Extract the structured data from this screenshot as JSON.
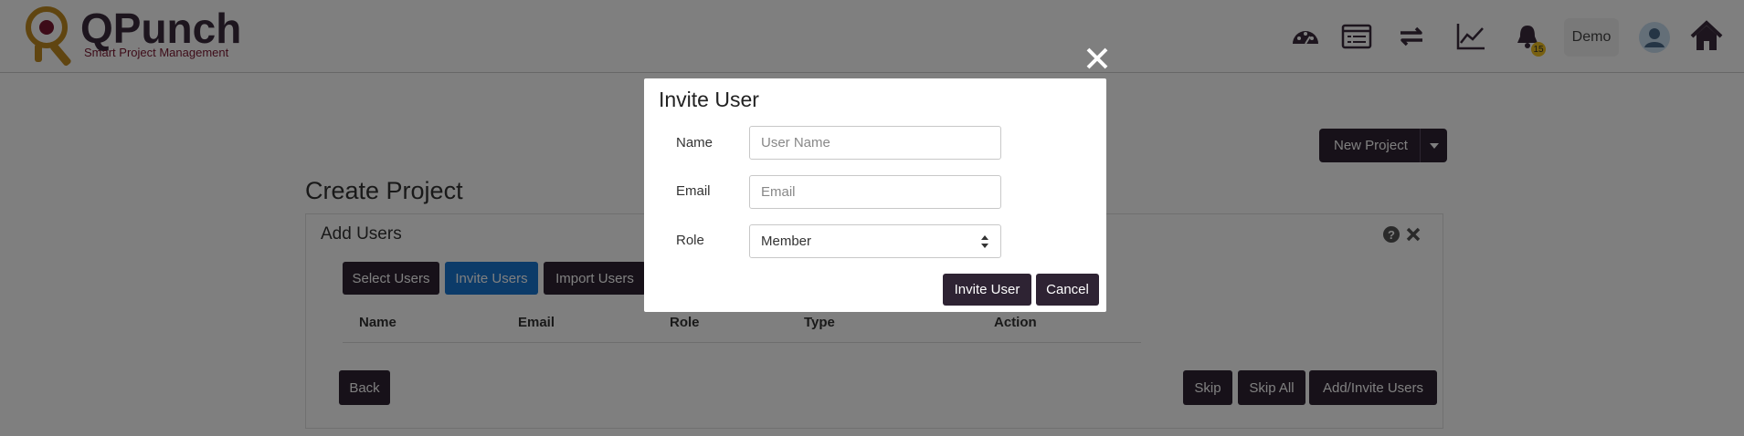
{
  "header": {
    "logo_title": "QPunch",
    "logo_subtitle": "Smart Project Management",
    "user_label": "Demo",
    "notification_count": "15",
    "icons": [
      "dashboard-icon",
      "list-icon",
      "sync-icon",
      "chart-icon",
      "bell-icon",
      "avatar",
      "home-icon"
    ]
  },
  "page": {
    "title": "Create Project",
    "new_project_label": "New Project"
  },
  "panel": {
    "title": "Add Users",
    "tabs": [
      {
        "label": "Select Users",
        "active": false
      },
      {
        "label": "Invite Users",
        "active": true
      },
      {
        "label": "Import Users",
        "active": false
      }
    ],
    "columns": [
      "Name",
      "Email",
      "Role",
      "Type",
      "Action"
    ],
    "back_label": "Back",
    "skip_label": "Skip",
    "skip_all_label": "Skip All",
    "add_invite_label": "Add/Invite Users"
  },
  "modal": {
    "title": "Invite User",
    "name_label": "Name",
    "name_placeholder": "User Name",
    "email_label": "Email",
    "email_placeholder": "Email",
    "role_label": "Role",
    "role_value": "Member",
    "invite_label": "Invite User",
    "cancel_label": "Cancel"
  },
  "colors": {
    "primary_dark": "#2e2333",
    "active_tab": "#1976d2",
    "logo_accent": "#7a1630",
    "overlay": "rgba(0,0,0,0.5)"
  }
}
